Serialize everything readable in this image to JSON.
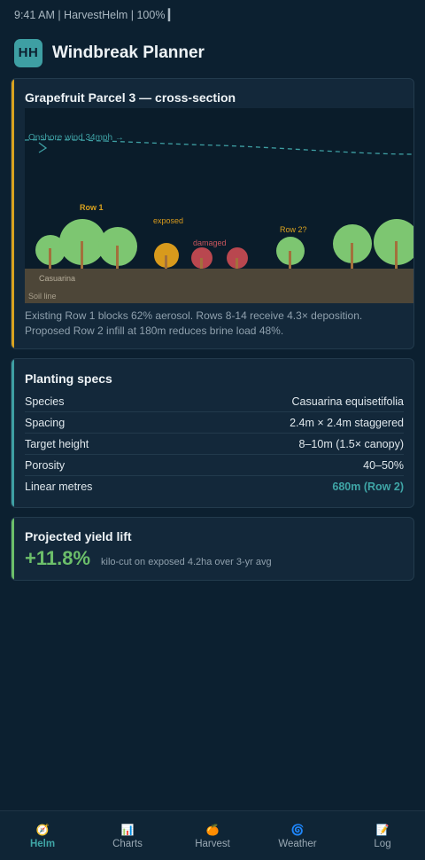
{
  "status": {
    "text": "9:41 AM | HarvestHelm | 100% ▎"
  },
  "app": {
    "logo": "HH",
    "title": "Windbreak Planner"
  },
  "cross_section": {
    "title": "Grapefruit Parcel 3 — cross-section",
    "wind_label": "Onshore wind 34mph →",
    "labels": {
      "row1": "Row 1",
      "exposed": "exposed",
      "damaged": "damaged",
      "row2": "Row 2?",
      "species": "Casuarina",
      "soil": "Soil line"
    },
    "colors": {
      "healthy": "#7dc671",
      "exposed": "#d89a1c",
      "damaged": "#b9474f",
      "trunk": "#a3703c",
      "soil": "#4d4638",
      "wind": "#3e9fa3",
      "sky": "#0a1c2a"
    },
    "caption": "Existing Row 1 blocks 62% aerosol. Rows 8-14 receive 4.3× deposition. Proposed Row 2 infill at 180m reduces brine load 48%."
  },
  "specs": {
    "title": "Planting specs",
    "rows": [
      {
        "label": "Species",
        "value": "Casuarina equisetifolia"
      },
      {
        "label": "Spacing",
        "value": "2.4m × 2.4m staggered"
      },
      {
        "label": "Target height",
        "value": "8–10m (1.5× canopy)"
      },
      {
        "label": "Porosity",
        "value": "40–50%"
      },
      {
        "label": "Linear metres",
        "value": "680m (Row 2)"
      }
    ]
  },
  "yield": {
    "title": "Projected yield lift",
    "value": "+11.8%",
    "note": "kilo-cut on exposed 4.2ha over 3-yr avg"
  },
  "nav": {
    "items": [
      {
        "icon": "🧭",
        "label": "Helm"
      },
      {
        "icon": "📊",
        "label": "Charts"
      },
      {
        "icon": "🍊",
        "label": "Harvest"
      },
      {
        "icon": "🌀",
        "label": "Weather"
      },
      {
        "icon": "📝",
        "label": "Log"
      }
    ]
  }
}
